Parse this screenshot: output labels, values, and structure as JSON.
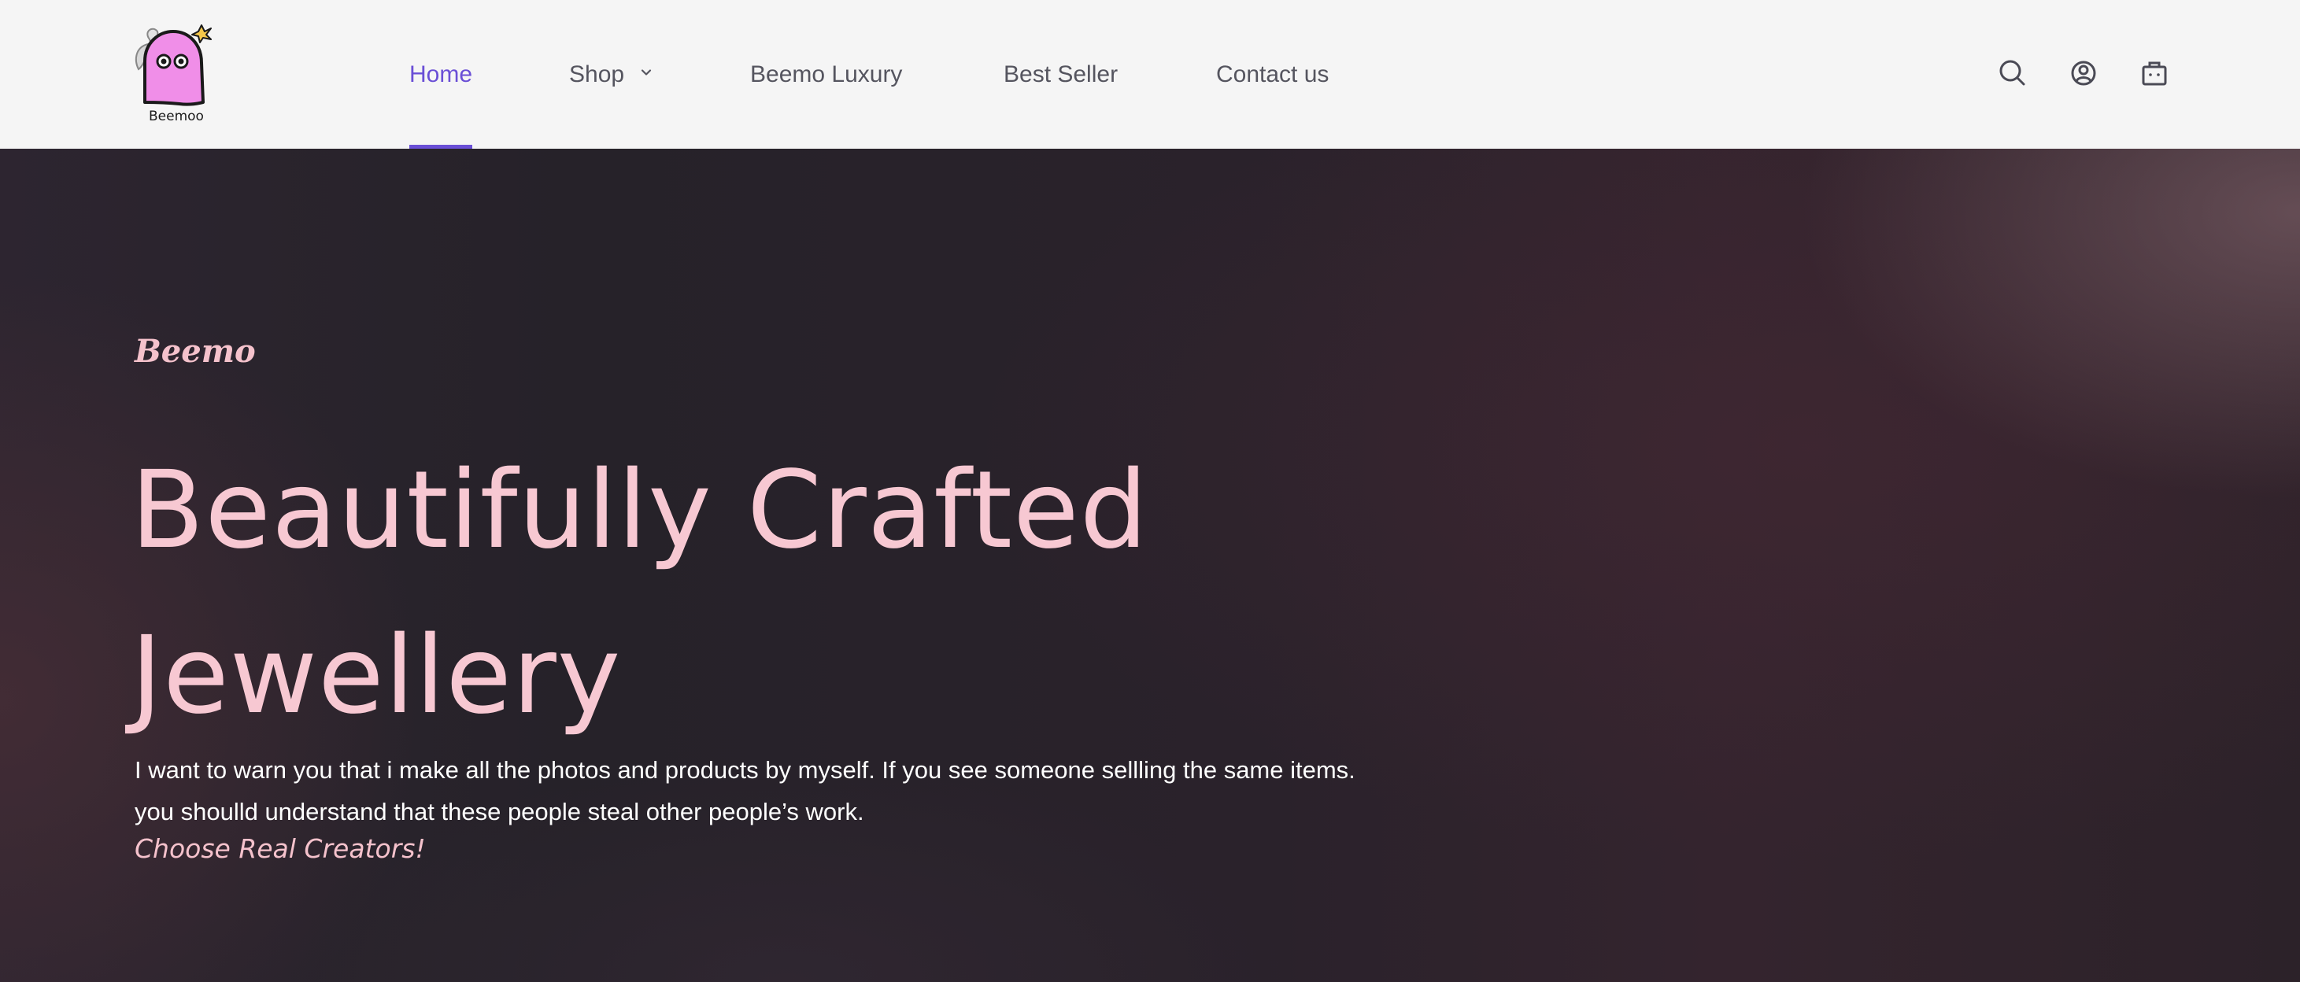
{
  "brand": {
    "logo_text": "Beemoo",
    "logo_icon": "pink-ghost-logo"
  },
  "nav": {
    "items": [
      {
        "label": "Home",
        "active": true
      },
      {
        "label": "Shop",
        "has_dropdown": true
      },
      {
        "label": "Beemo Luxury"
      },
      {
        "label": "Best Seller"
      },
      {
        "label": "Contact us"
      }
    ]
  },
  "header_icons": [
    "search-icon",
    "account-icon",
    "cart-icon"
  ],
  "hero": {
    "eyebrow": "Beemo",
    "title_line1": "Beautifully Crafted",
    "title_line2": "Jewellery",
    "description": "I want to warn you that i make all the photos and products by myself. If you see someone sellling the same items. you shoulld understand that these people steal other people’s work.",
    "tagline": "Choose Real Creators!"
  },
  "colors": {
    "accent": "#6a4fd6",
    "header_bg": "#f5f5f5",
    "hero_bg": "#262229",
    "hero_text_pink": "#f7c8d2",
    "logo_pink": "#f08ee8"
  }
}
